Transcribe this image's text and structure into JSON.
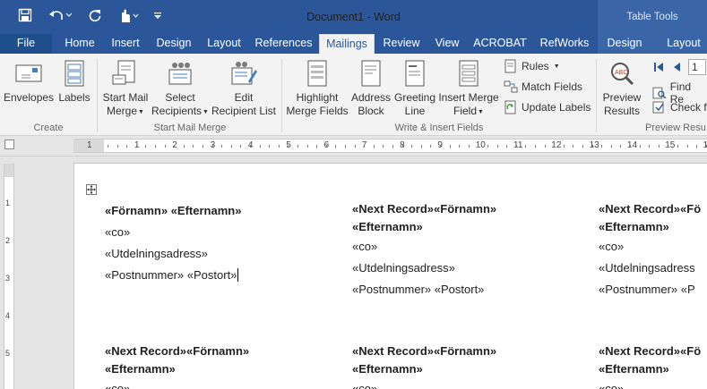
{
  "window": {
    "title": "Document1 - Word",
    "contextual_title": "Table Tools"
  },
  "quick_access": {
    "save_icon": "save-icon",
    "undo_icon": "undo-icon",
    "redo_icon": "redo-icon",
    "touch_icon": "touch-mode-icon",
    "customize_icon": "customize-qat-icon"
  },
  "tabs": [
    {
      "label": "File"
    },
    {
      "label": "Home"
    },
    {
      "label": "Insert"
    },
    {
      "label": "Design"
    },
    {
      "label": "Layout"
    },
    {
      "label": "References"
    },
    {
      "label": "Mailings"
    },
    {
      "label": "Review"
    },
    {
      "label": "View"
    },
    {
      "label": "ACROBAT"
    },
    {
      "label": "RefWorks"
    },
    {
      "label": "Design"
    },
    {
      "label": "Layout"
    }
  ],
  "ribbon": {
    "create": {
      "label": "Create",
      "envelopes": "Envelopes",
      "labels": "Labels"
    },
    "start_mail_merge": {
      "label": "Start Mail Merge",
      "start_line1": "Start Mail",
      "start_line2": "Merge",
      "select_line1": "Select",
      "select_line2": "Recipients",
      "edit_line1": "Edit",
      "edit_line2": "Recipient List"
    },
    "write_insert": {
      "label": "Write & Insert Fields",
      "highlight_line1": "Highlight",
      "highlight_line2": "Merge Fields",
      "address_line1": "Address",
      "address_line2": "Block",
      "greeting_line1": "Greeting",
      "greeting_line2": "Line",
      "insert_line1": "Insert Merge",
      "insert_line2": "Field",
      "rules": "Rules",
      "match_fields": "Match Fields",
      "update_labels": "Update Labels"
    },
    "preview": {
      "label": "Preview Resu",
      "preview_line1": "Preview",
      "preview_line2": "Results",
      "record_value": "1",
      "find": "Find Re",
      "check": "Check f"
    }
  },
  "ruler": {
    "numbers": [
      "1",
      "1",
      "2",
      "3",
      "4",
      "5",
      "6",
      "7",
      "8",
      "9",
      "10",
      "11",
      "12",
      "13",
      "14",
      "15",
      "16"
    ],
    "vnumbers": [
      "1",
      "2",
      "3",
      "4",
      "5"
    ]
  },
  "document": {
    "cells": [
      {
        "lines_bold": [
          "«Förnamn» «Efternamn»"
        ],
        "lines": [
          "«co»",
          "«Utdelningsadress»",
          "«Postnummer» «Postort»"
        ]
      },
      {
        "lines_bold": [
          "«Next Record»«Förnamn»",
          "«Efternamn»"
        ],
        "lines": [
          "«co»",
          "«Utdelningsadress»",
          "«Postnummer» «Postort»"
        ]
      },
      {
        "lines_bold": [
          "«Next Record»«Fö",
          "«Efternamn»"
        ],
        "lines": [
          "«co»",
          "«Utdelningsadress",
          "«Postnummer» «P"
        ]
      },
      {
        "lines_bold": [
          "«Next Record»«Förnamn»",
          "«Efternamn»"
        ],
        "lines": [
          "«co»"
        ]
      },
      {
        "lines_bold": [
          "«Next Record»«Förnamn»",
          "«Efternamn»"
        ],
        "lines": [
          "«co»"
        ]
      },
      {
        "lines_bold": [
          "«Next Record»«Fö",
          "«Efternamn»"
        ],
        "lines": [
          "«co»"
        ]
      }
    ]
  },
  "colors": {
    "word_blue": "#2b579a",
    "ribbon_bg": "#f3f3f3"
  }
}
